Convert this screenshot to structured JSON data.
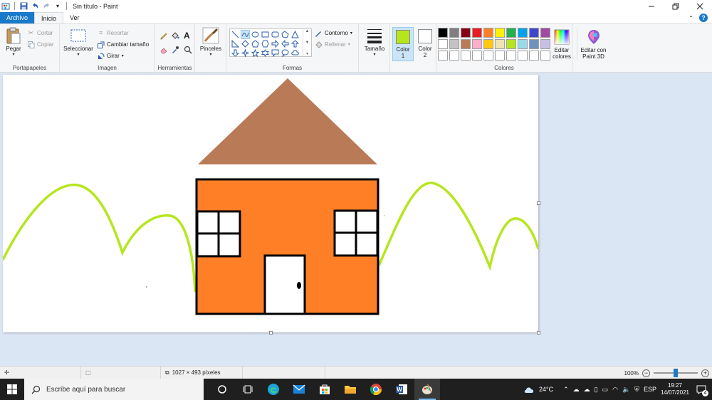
{
  "titlebar": {
    "title": "Sin título - Paint",
    "quick_access": [
      "paint-app-icon",
      "save-icon",
      "undo-icon",
      "redo-icon",
      "customize-icon"
    ],
    "controls": [
      "minimize-icon",
      "restore-icon",
      "close-icon"
    ]
  },
  "tabs": {
    "file": "Archivo",
    "home": "Inicio",
    "view": "Ver"
  },
  "ribbon": {
    "clipboard": {
      "label": "Portapapeles",
      "paste": "Pegar",
      "cut": "Cortar",
      "copy": "Copiar"
    },
    "image": {
      "label": "Imagen",
      "select": "Seleccionar",
      "crop": "Recortar",
      "resize": "Cambiar tamaño",
      "rotate": "Girar"
    },
    "tools": {
      "label": "Herramientas"
    },
    "brushes": {
      "label": "Pinceles"
    },
    "shapes": {
      "label": "Formas",
      "outline": "Contorno",
      "fill": "Rellenar"
    },
    "size": {
      "label": "Tamaño"
    },
    "color1": {
      "label1": "Color",
      "label2": "1",
      "value": "#b5e61d"
    },
    "color2": {
      "label1": "Color",
      "label2": "2",
      "value": "#ffffff"
    },
    "colors": {
      "label": "Colores",
      "row1": [
        "#000000",
        "#7f7f7f",
        "#880015",
        "#ed1c24",
        "#ff7f27",
        "#fff200",
        "#22b14c",
        "#00a2e8",
        "#3f48cc",
        "#a349a4"
      ],
      "row2": [
        "#ffffff",
        "#c3c3c3",
        "#b97a57",
        "#ffaec9",
        "#ffc90e",
        "#efe4b0",
        "#b5e61d",
        "#99d9ea",
        "#7092be",
        "#c8bfe7"
      ],
      "row3_blank": 10
    },
    "edit_colors": {
      "line1": "Editar",
      "line2": "colores"
    },
    "paint3d": {
      "line1": "Editar con",
      "line2": "Paint 3D"
    }
  },
  "drawing": {
    "roof_color": "#b97a57",
    "house_color": "#ff7f27",
    "outline_color": "#000000",
    "hill_color": "#b5e61d",
    "window_color": "#ffffff",
    "door_color": "#ffffff"
  },
  "statusbar": {
    "dimensions": "1027 × 493 píxeles",
    "zoom": "100%"
  },
  "taskbar": {
    "search_placeholder": "Escribe aquí para buscar",
    "temperature": "24°C",
    "language": "ESP",
    "time": "19:27",
    "date": "14/07/2021",
    "notifications": "4"
  }
}
